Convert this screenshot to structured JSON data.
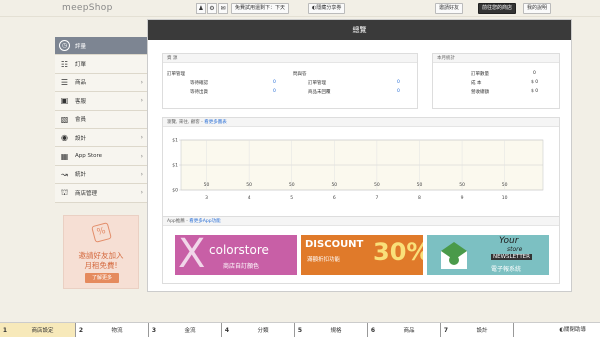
{
  "header": {
    "brand": "meepShop",
    "icons": [
      "user-icon",
      "gear-icon",
      "chat-icon"
    ],
    "trial": "免費試用還剩下：下天",
    "share": "◐隱藏分享券",
    "invite": "邀請好友",
    "go_store": "前往您的商店",
    "help": "我的說明"
  },
  "sidebar": {
    "items": [
      {
        "label": "評量",
        "icon": "clock-icon",
        "arrow": ""
      },
      {
        "label": "訂單",
        "icon": "cart-icon",
        "arrow": ""
      },
      {
        "label": "商品",
        "icon": "list-icon",
        "arrow": "›"
      },
      {
        "label": "客服",
        "icon": "briefcase-icon",
        "arrow": "›"
      },
      {
        "label": "會員",
        "icon": "member-icon",
        "arrow": ""
      },
      {
        "label": "設計",
        "icon": "palette-icon",
        "arrow": "›"
      },
      {
        "label": "App Store",
        "icon": "grid-icon",
        "arrow": "›"
      },
      {
        "label": "統計",
        "icon": "chart-icon",
        "arrow": "›"
      },
      {
        "label": "商店管理",
        "icon": "store-icon",
        "arrow": "›"
      }
    ]
  },
  "promo": {
    "line1": "邀請好友加入",
    "line2": "月租免費!",
    "button": "了解更多"
  },
  "main": {
    "title": "總覽",
    "data_panel": {
      "title": "資 源",
      "col1_title": "訂單管理",
      "col2_title": "問與答",
      "rows_left": [
        {
          "label": "等待確認",
          "value": "0"
        },
        {
          "label": "等待出貨",
          "value": "0"
        }
      ],
      "rows_right": [
        {
          "label": "訂單管理",
          "value": "0"
        },
        {
          "label": "商品未回覆",
          "value": "0"
        }
      ]
    },
    "month_panel": {
      "title": "本月統計",
      "rows": [
        {
          "label": "訂單數量",
          "value": "0"
        },
        {
          "label": "成 本",
          "value": "$ 0"
        },
        {
          "label": "營收總額",
          "value": "$ 0"
        }
      ]
    },
    "chart_panel": {
      "title": "瀏覽, 來往, 顧客 - ",
      "link": "看更多圖表"
    },
    "app_panel": {
      "title": "App推薦 - ",
      "link": "看更多App功能",
      "banners": [
        {
          "name": "colorstore",
          "big": "X",
          "brand": "colorstore",
          "sub": "商店自訂顏色",
          "bg": "#c85fa6"
        },
        {
          "name": "discount",
          "top": "DISCOUNT",
          "sub": "滿額折扣功能",
          "pct": "30%",
          "bg": "#e07a2a"
        },
        {
          "name": "newsletter",
          "your": "Your",
          "store": "store",
          "news": "NEWSLETTER",
          "sub": "電子報系統",
          "bg": "#7cc0c2"
        }
      ]
    }
  },
  "chart_data": {
    "type": "bar",
    "categories": [
      "3",
      "4",
      "5",
      "6",
      "7",
      "8",
      "9",
      "10"
    ],
    "values": [
      0,
      0,
      0,
      0,
      0,
      0,
      0,
      0
    ],
    "data_labels": [
      "50",
      "50",
      "50",
      "50",
      "50",
      "50",
      "50",
      "50"
    ],
    "ytick_labels": [
      "$1",
      "$1",
      "$0"
    ],
    "ylim": [
      0,
      1
    ],
    "grid": true
  },
  "bottombar": {
    "steps": [
      {
        "n": "1",
        "label": "商店設定"
      },
      {
        "n": "2",
        "label": "物流"
      },
      {
        "n": "3",
        "label": "金流"
      },
      {
        "n": "4",
        "label": "分類"
      },
      {
        "n": "5",
        "label": "規格"
      },
      {
        "n": "6",
        "label": "商品"
      },
      {
        "n": "7",
        "label": "設計"
      }
    ],
    "guide": "◐關閉助導"
  },
  "colors": {
    "accent_blue": "#2a6fd6",
    "sidebar_active": "#7d8592",
    "step_active": "#f7e9ba"
  }
}
